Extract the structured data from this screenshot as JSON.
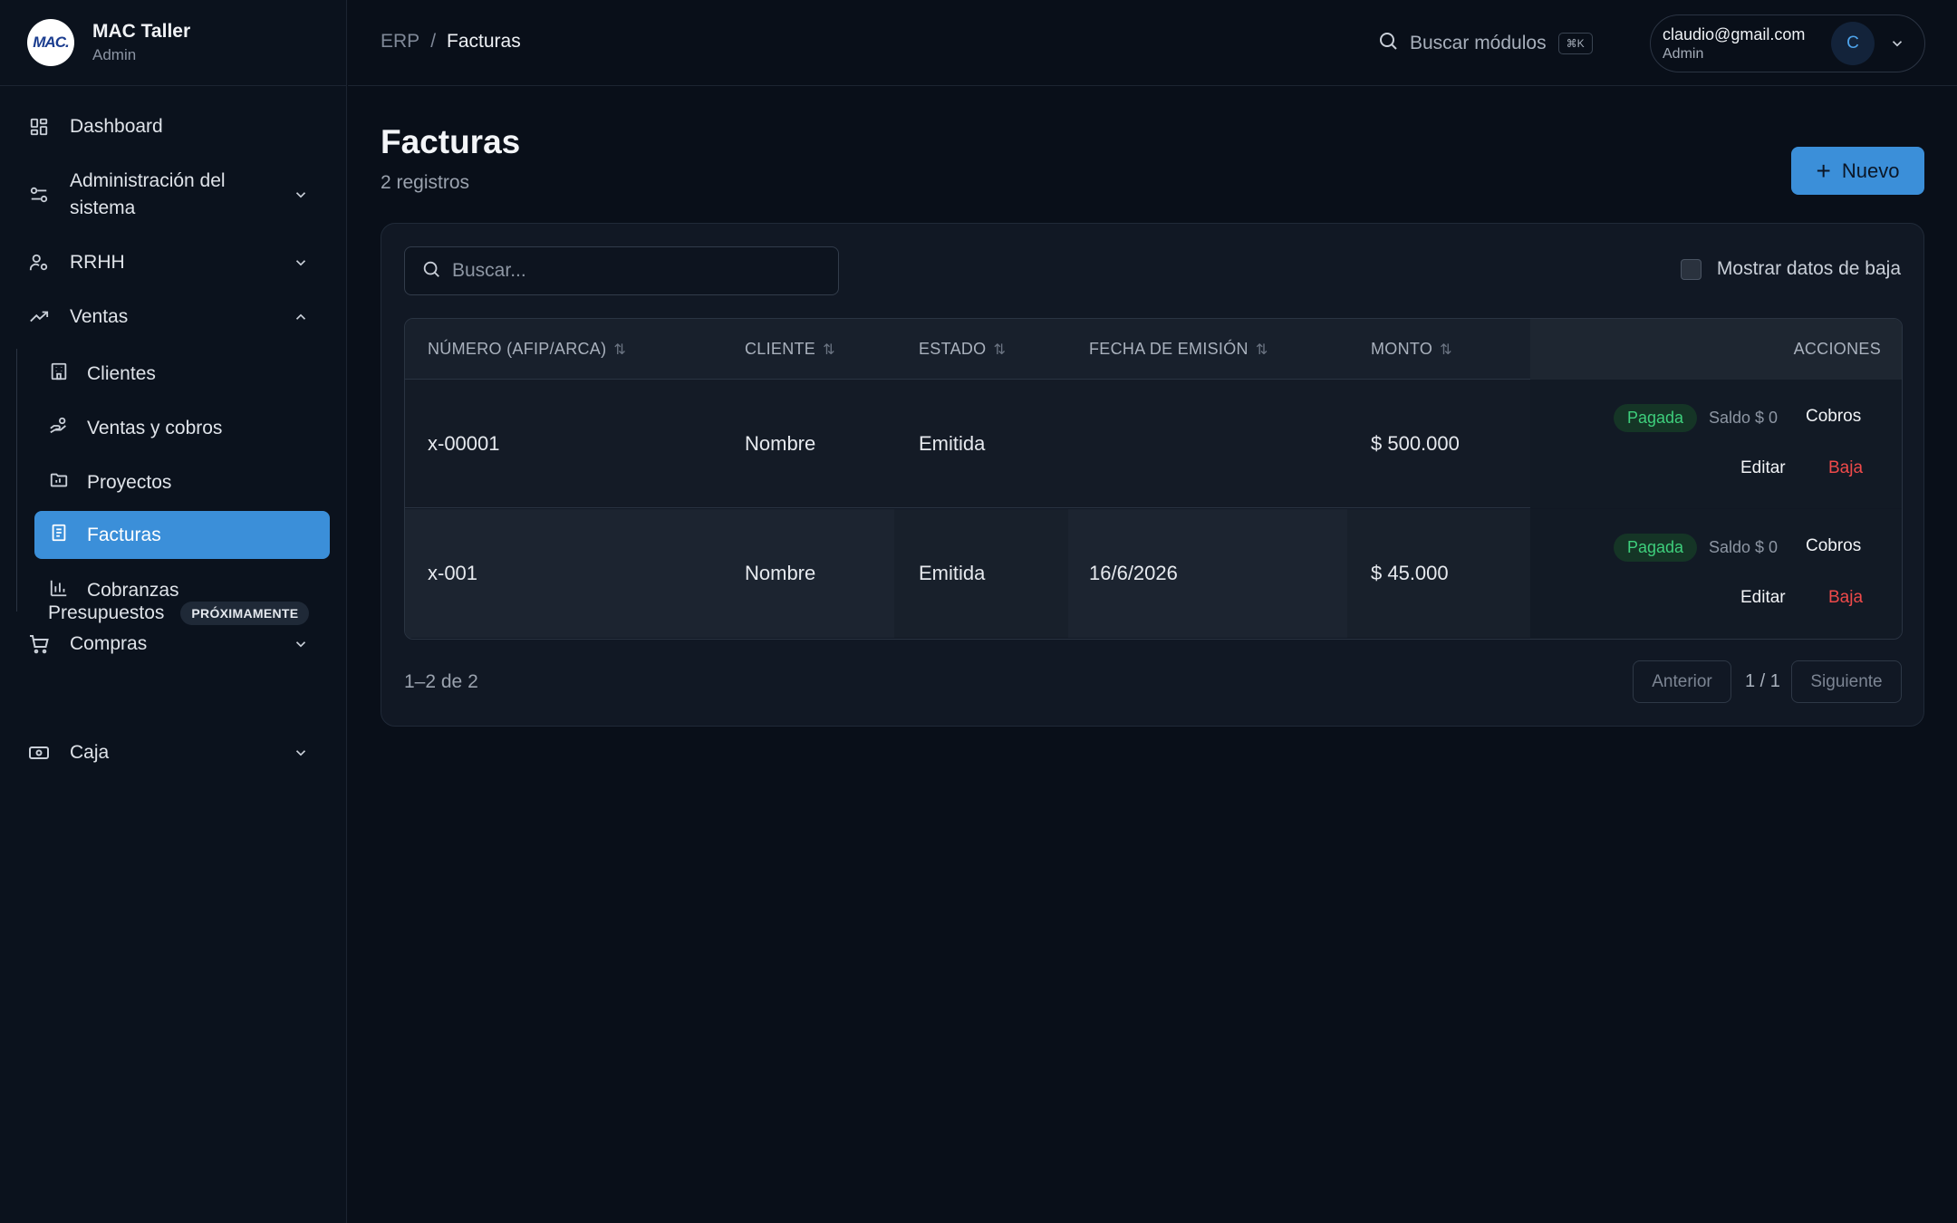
{
  "brand": {
    "logo_text": "MAC.",
    "name": "MAC Taller",
    "role": "Admin"
  },
  "sidebar": {
    "items": [
      {
        "label": "Dashboard",
        "icon": "dashboard-icon"
      },
      {
        "label": "Administración del sistema",
        "icon": "settings-sliders-icon",
        "expanded": false
      },
      {
        "label": "RRHH",
        "icon": "user-gear-icon",
        "expanded": false
      },
      {
        "label": "Ventas",
        "icon": "trending-up-icon",
        "expanded": true
      },
      {
        "label": "Compras",
        "icon": "cart-icon",
        "expanded": false
      },
      {
        "label": "Caja",
        "icon": "cash-icon",
        "expanded": false
      }
    ],
    "ventas_sub": [
      {
        "label": "Clientes",
        "icon": "building-icon"
      },
      {
        "label": "Ventas y cobros",
        "icon": "hand-coins-icon"
      },
      {
        "label": "Proyectos",
        "icon": "folder-chart-icon"
      },
      {
        "label": "Facturas",
        "icon": "document-icon",
        "active": true
      },
      {
        "label": "Cobranzas",
        "icon": "bar-chart-icon"
      }
    ],
    "presupuestos": {
      "label": "Presupuestos",
      "badge": "PRÓXIMAMENTE"
    }
  },
  "topbar": {
    "breadcrumb_root": "ERP",
    "breadcrumb_sep": "/",
    "breadcrumb_current": "Facturas",
    "search_label": "Buscar módulos",
    "search_kbd": "⌘K",
    "user_email": "claudio@gmail.com",
    "user_role": "Admin",
    "user_initial": "C"
  },
  "page": {
    "title": "Facturas",
    "subtitle": "2 registros",
    "new_button": "Nuevo",
    "new_button_plus": "+"
  },
  "filters": {
    "search_placeholder": "Buscar...",
    "show_deleted_label": "Mostrar datos de baja",
    "show_deleted_checked": false
  },
  "table": {
    "headers": {
      "numero": "NÚMERO (AFIP/ARCA)",
      "cliente": "CLIENTE",
      "estado": "ESTADO",
      "fecha": "FECHA DE EMISIÓN",
      "monto": "MONTO",
      "acciones": "ACCIONES"
    },
    "sort_glyph": "⇅",
    "rows": [
      {
        "numero": "x-00001",
        "cliente": "Nombre",
        "estado": "Emitida",
        "fecha": "",
        "monto": "$ 500.000",
        "status": "Pagada",
        "saldo": "Saldo $ 0",
        "cobros": "Cobros",
        "editar": "Editar",
        "baja": "Baja"
      },
      {
        "numero": "x-001",
        "cliente": "Nombre",
        "estado": "Emitida",
        "fecha": "16/6/2026",
        "monto": "$ 45.000",
        "status": "Pagada",
        "saldo": "Saldo $ 0",
        "cobros": "Cobros",
        "editar": "Editar",
        "baja": "Baja"
      }
    ]
  },
  "pagination": {
    "range": "1–2 de 2",
    "prev": "Anterior",
    "page_info": "1 / 1",
    "next": "Siguiente"
  },
  "colors": {
    "accent": "#3b8fd9",
    "success": "#3ecf7c",
    "danger": "#ef4a4a",
    "background": "#090f19"
  }
}
